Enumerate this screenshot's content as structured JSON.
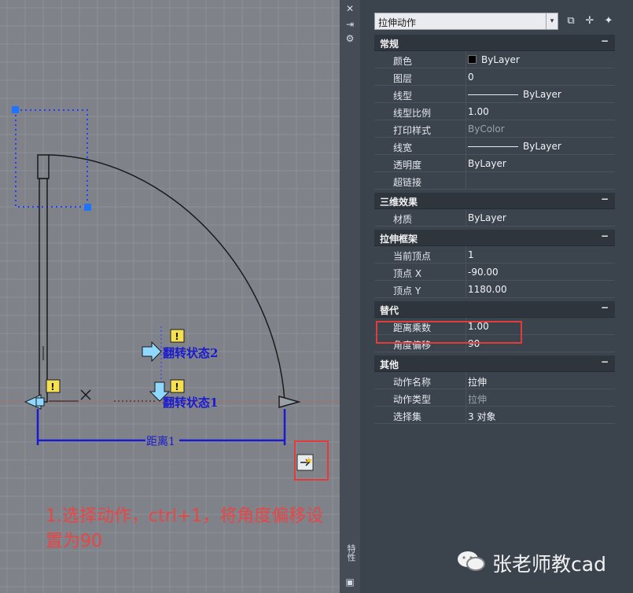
{
  "palette": {
    "selector_value": "拉伸动作",
    "side_title": "特性",
    "sections": [
      {
        "title": "常规",
        "rows": [
          {
            "key": "颜色",
            "value": "ByLayer",
            "kind": "color"
          },
          {
            "key": "图层",
            "value": "0"
          },
          {
            "key": "线型",
            "value": "ByLayer",
            "kind": "line"
          },
          {
            "key": "线型比例",
            "value": "1.00"
          },
          {
            "key": "打印样式",
            "value": "ByColor",
            "dim": true
          },
          {
            "key": "线宽",
            "value": "ByLayer",
            "kind": "line"
          },
          {
            "key": "透明度",
            "value": "ByLayer"
          },
          {
            "key": "超链接",
            "value": ""
          }
        ]
      },
      {
        "title": "三维效果",
        "rows": [
          {
            "key": "材质",
            "value": "ByLayer"
          }
        ]
      },
      {
        "title": "拉伸框架",
        "rows": [
          {
            "key": "当前顶点",
            "value": "1"
          },
          {
            "key": "顶点 X",
            "value": "-90.00"
          },
          {
            "key": "顶点 Y",
            "value": "1180.00"
          }
        ]
      },
      {
        "title": "替代",
        "rows": [
          {
            "key": "距离乘数",
            "value": "1.00"
          },
          {
            "key": "角度偏移",
            "value": "90"
          }
        ]
      },
      {
        "title": "其他",
        "rows": [
          {
            "key": "动作名称",
            "value": "拉伸"
          },
          {
            "key": "动作类型",
            "value": "拉伸",
            "dim": true
          },
          {
            "key": "选择集",
            "value": "3 对象"
          }
        ]
      }
    ]
  },
  "drawing": {
    "flip_state_2": "翻转状态2",
    "flip_state_1": "翻转状态1",
    "distance_label": "距离1",
    "warning_glyph": "!"
  },
  "caption": "1.选择动作，ctrl+1，将角度偏移设置为90",
  "brand": "张老师教cad",
  "colors": {
    "accent_red": "#e23b3b",
    "param_blue": "#1a1ad0",
    "grip_blue": "#1e73ff",
    "arrow_cyan": "#8fd8ff"
  }
}
